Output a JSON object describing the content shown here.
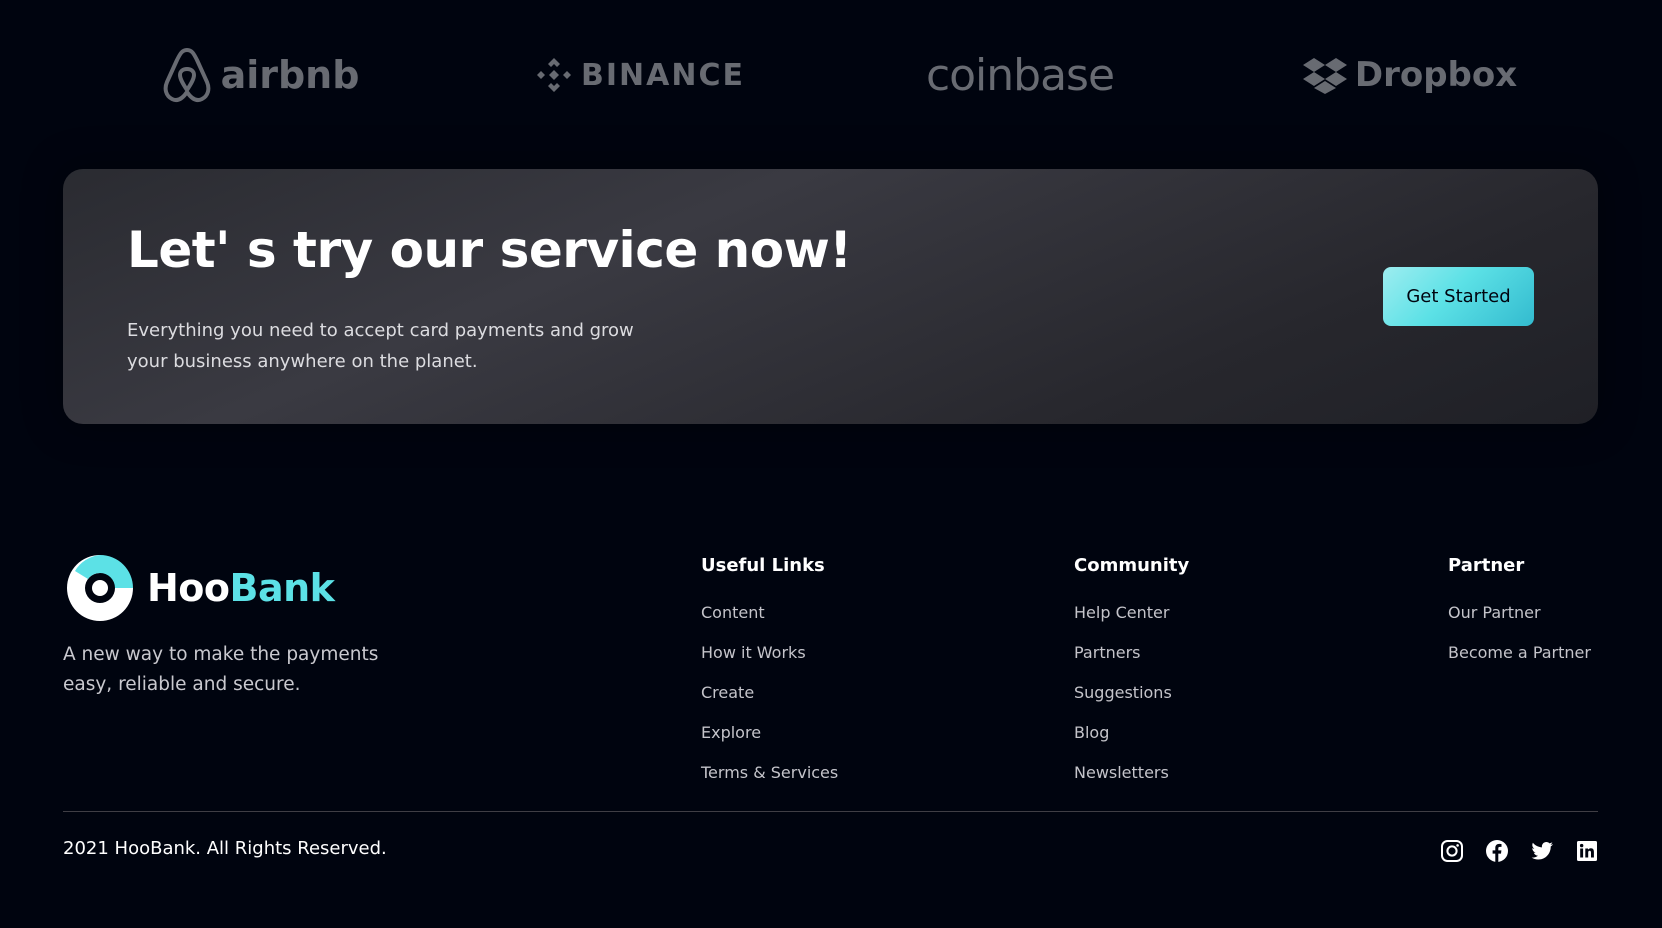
{
  "clients": [
    {
      "name": "airbnb",
      "icon": "airbnb-logo-icon"
    },
    {
      "name": "BINANCE",
      "icon": "binance-logo-icon"
    },
    {
      "name": "coinbase",
      "icon": ""
    },
    {
      "name": "Dropbox",
      "icon": "dropbox-logo-icon"
    }
  ],
  "cta": {
    "title": "Let' s try our service now!",
    "text": "Everything you need to accept card payments and grow your business anywhere on the planet.",
    "button_label": "Get Started"
  },
  "footer": {
    "brand": {
      "name_part1": "Hoo",
      "name_part2": "Bank",
      "logo_icon": "hoobank-logo-icon"
    },
    "tagline": "A new way to make the payments easy, reliable and secure.",
    "columns": [
      {
        "title": "Useful Links",
        "links": [
          "Content",
          "How it Works",
          "Create",
          "Explore",
          "Terms & Services"
        ]
      },
      {
        "title": "Community",
        "links": [
          "Help Center",
          "Partners",
          "Suggestions",
          "Blog",
          "Newsletters"
        ]
      },
      {
        "title": "Partner",
        "links": [
          "Our Partner",
          "Become a Partner"
        ]
      }
    ],
    "copyright": "2021 HooBank. All Rights Reserved.",
    "social": [
      "instagram-icon",
      "facebook-icon",
      "twitter-icon",
      "linkedin-icon"
    ]
  },
  "colors": {
    "background": "#00040f",
    "accent": "#5ce1e6",
    "card": "#2f3037",
    "muted_text": "#c4c4ca",
    "logo_grey": "#7b7d84"
  }
}
